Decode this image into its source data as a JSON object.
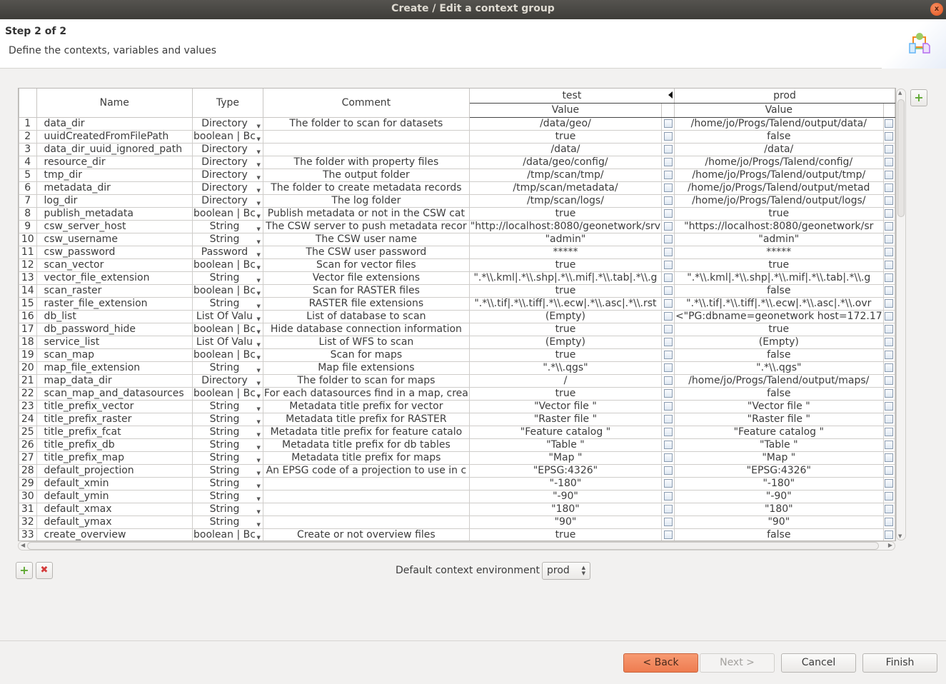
{
  "window": {
    "title": "Create / Edit a context group",
    "close_icon": "x"
  },
  "header": {
    "step": "Step 2 of 2",
    "description": "Define the contexts, variables and values",
    "icon": "context-group-wizard-icon"
  },
  "table": {
    "columns": {
      "name": "Name",
      "type": "Type",
      "comment": "Comment",
      "context1": "test",
      "context2": "prod",
      "value_label": "Value"
    },
    "rows": [
      {
        "num": "1",
        "name": "data_dir",
        "type": "Directory",
        "comment": "The folder to scan for datasets",
        "test": "/data/geo/",
        "prod": "/home/jo/Progs/Talend/output/data/"
      },
      {
        "num": "2",
        "name": "uuidCreatedFromFilePath",
        "type": "boolean | Bc",
        "comment": "",
        "test": "true",
        "prod": "false"
      },
      {
        "num": "3",
        "name": "data_dir_uuid_ignored_path",
        "type": "Directory",
        "comment": "",
        "test": "/data/",
        "prod": "/data/"
      },
      {
        "num": "4",
        "name": "resource_dir",
        "type": "Directory",
        "comment": "The folder with property files",
        "test": "/data/geo/config/",
        "prod": "/home/jo/Progs/Talend/config/"
      },
      {
        "num": "5",
        "name": "tmp_dir",
        "type": "Directory",
        "comment": "The output folder",
        "test": "/tmp/scan/tmp/",
        "prod": "/home/jo/Progs/Talend/output/tmp/"
      },
      {
        "num": "6",
        "name": "metadata_dir",
        "type": "Directory",
        "comment": "The folder to create metadata records",
        "test": "/tmp/scan/metadata/",
        "prod": "/home/jo/Progs/Talend/output/metad"
      },
      {
        "num": "7",
        "name": "log_dir",
        "type": "Directory",
        "comment": "The log folder",
        "test": "/tmp/scan/logs/",
        "prod": "/home/jo/Progs/Talend/output/logs/"
      },
      {
        "num": "8",
        "name": "publish_metadata",
        "type": "boolean | Bc",
        "comment": "Publish metadata or not in the CSW cat",
        "test": "true",
        "prod": "true"
      },
      {
        "num": "9",
        "name": "csw_server_host",
        "type": "String",
        "comment": "The CSW server to push metadata recor",
        "test": "\"http://localhost:8080/geonetwork/srv",
        "prod": "\"https://localhost:8080/geonetwork/sr"
      },
      {
        "num": "10",
        "name": "csw_username",
        "type": "String",
        "comment": "The CSW user name",
        "test": "\"admin\"",
        "prod": "\"admin\""
      },
      {
        "num": "11",
        "name": "csw_password",
        "type": "Password",
        "comment": "The CSW user password",
        "test": "*****",
        "prod": "*****"
      },
      {
        "num": "12",
        "name": "scan_vector",
        "type": "boolean | Bc",
        "comment": "Scan for vector files",
        "test": "true",
        "prod": "true"
      },
      {
        "num": "13",
        "name": "vector_file_extension",
        "type": "String",
        "comment": "Vector file extensions",
        "test": "\".*\\\\.kml|.*\\\\.shp|.*\\\\.mif|.*\\\\.tab|.*\\\\.g",
        "prod": "\".*\\\\.kml|.*\\\\.shp|.*\\\\.mif|.*\\\\.tab|.*\\\\.g"
      },
      {
        "num": "14",
        "name": "scan_raster",
        "type": "boolean | Bc",
        "comment": "Scan for RASTER files",
        "test": "true",
        "prod": "false"
      },
      {
        "num": "15",
        "name": "raster_file_extension",
        "type": "String",
        "comment": "RASTER file extensions",
        "test": "\".*\\\\.tif|.*\\\\.tiff|.*\\\\.ecw|.*\\\\.asc|.*\\\\.rst",
        "prod": "\".*\\\\.tif|.*\\\\.tiff|.*\\\\.ecw|.*\\\\.asc|.*\\\\.ovr"
      },
      {
        "num": "16",
        "name": "db_list",
        "type": "List Of Valu",
        "comment": "List of database to scan",
        "test": "(Empty)",
        "prod": "<\"PG:dbname=geonetwork host=172.17"
      },
      {
        "num": "17",
        "name": "db_password_hide",
        "type": "boolean | Bc",
        "comment": "Hide database connection information",
        "test": "true",
        "prod": "true"
      },
      {
        "num": "18",
        "name": "service_list",
        "type": "List Of Valu",
        "comment": "List of WFS to scan",
        "test": "(Empty)",
        "prod": "(Empty)"
      },
      {
        "num": "19",
        "name": "scan_map",
        "type": "boolean | Bc",
        "comment": "Scan for maps",
        "test": "true",
        "prod": "false"
      },
      {
        "num": "20",
        "name": "map_file_extension",
        "type": "String",
        "comment": "Map file extensions",
        "test": "\".*\\\\.qgs\"",
        "prod": "\".*\\\\.qgs\""
      },
      {
        "num": "21",
        "name": "map_data_dir",
        "type": "Directory",
        "comment": "The folder to scan for maps",
        "test": "/",
        "prod": "/home/jo/Progs/Talend/output/maps/"
      },
      {
        "num": "22",
        "name": "scan_map_and_datasources",
        "type": "boolean | Bc",
        "comment": "For each datasources find in a map, crea",
        "test": "true",
        "prod": "false"
      },
      {
        "num": "23",
        "name": "title_prefix_vector",
        "type": "String",
        "comment": "Metadata title prefix for vector",
        "test": "\"Vector file \"",
        "prod": "\"Vector file \""
      },
      {
        "num": "24",
        "name": "title_prefix_raster",
        "type": "String",
        "comment": "Metadata title prefix for RASTER",
        "test": "\"Raster file \"",
        "prod": "\"Raster file \""
      },
      {
        "num": "25",
        "name": "title_prefix_fcat",
        "type": "String",
        "comment": "Metadata title prefix for feature catalo",
        "test": "\"Feature catalog \"",
        "prod": "\"Feature catalog \""
      },
      {
        "num": "26",
        "name": "title_prefix_db",
        "type": "String",
        "comment": "Metadata title prefix for db tables",
        "test": "\"Table \"",
        "prod": "\"Table \""
      },
      {
        "num": "27",
        "name": "title_prefix_map",
        "type": "String",
        "comment": "Metadata title prefix for maps",
        "test": "\"Map \"",
        "prod": "\"Map \""
      },
      {
        "num": "28",
        "name": "default_projection",
        "type": "String",
        "comment": "An EPSG code of a projection to use in c",
        "test": "\"EPSG:4326\"",
        "prod": "\"EPSG:4326\""
      },
      {
        "num": "29",
        "name": "default_xmin",
        "type": "String",
        "comment": "",
        "test": "\"-180\"",
        "prod": "\"-180\""
      },
      {
        "num": "30",
        "name": "default_ymin",
        "type": "String",
        "comment": "",
        "test": "\"-90\"",
        "prod": "\"-90\""
      },
      {
        "num": "31",
        "name": "default_xmax",
        "type": "String",
        "comment": "",
        "test": "\"180\"",
        "prod": "\"180\""
      },
      {
        "num": "32",
        "name": "default_ymax",
        "type": "String",
        "comment": "",
        "test": "\"90\"",
        "prod": "\"90\""
      },
      {
        "num": "33",
        "name": "create_overview",
        "type": "boolean | Bc",
        "comment": "Create or not overview files",
        "test": "true",
        "prod": "false"
      }
    ]
  },
  "actions": {
    "add_context_icon": "+",
    "add_variable_icon": "+",
    "remove_variable_icon": "✖"
  },
  "default_env": {
    "label": "Default context environment",
    "value": "prod"
  },
  "footer": {
    "back": "< Back",
    "next": "Next >",
    "cancel": "Cancel",
    "finish": "Finish"
  }
}
